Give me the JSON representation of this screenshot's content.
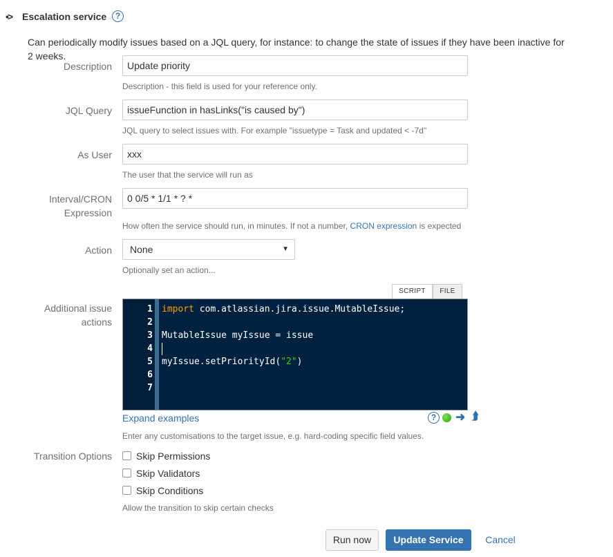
{
  "header": {
    "expander": "•>",
    "title": "Escalation service",
    "help": "?",
    "description": "Can periodically modify issues based on a JQL query, for instance: to change the state of issues if they have been inactive for 2 weeks."
  },
  "fields": {
    "description": {
      "label": "Description",
      "value": "Update priority",
      "hint": "Description - this field is used for your reference only."
    },
    "jql": {
      "label": "JQL Query",
      "value": "issueFunction in hasLinks(\"is caused by\")",
      "hint": "JQL query to select issues with. For example \"issuetype = Task and updated < -7d\""
    },
    "as_user": {
      "label": "As User",
      "value": "xxx",
      "hint": "The user that the service will run as"
    },
    "interval": {
      "label_line1": "Interval/CRON",
      "label_line2": "Expression",
      "value": "0 0/5 * 1/1 * ? *",
      "hint_prefix": "How often the service should run, in minutes. If not a number,",
      "hint_link": "CRON expression",
      "hint_suffix": "is expected"
    },
    "action": {
      "label": "Action",
      "selected": "None",
      "caret": "▼",
      "hint": "Optionally set an action..."
    }
  },
  "additional_actions": {
    "label_line1": "Additional issue",
    "label_line2": "actions",
    "tabs": {
      "script": "SCRIPT",
      "file": "FILE"
    },
    "line_numbers": [
      "1",
      "2",
      "3",
      "4",
      "5",
      "6",
      "7"
    ],
    "code": {
      "line1_kw": "import",
      "line1_rest": " com.atlassian.jira.issue.MutableIssue;",
      "line3": "MutableIssue myIssue = issue",
      "line5_pre": "myIssue.setPriorityId(",
      "line5_str": "\"2\"",
      "line5_post": ")"
    },
    "expand_link": "Expand examples",
    "help": "?",
    "arrow_right": "➜",
    "arrow_up": "⮭",
    "hint": "Enter any customisations to the target issue, e.g. hard-coding specific field values."
  },
  "transition": {
    "label": "Transition Options",
    "options": [
      "Skip Permissions",
      "Skip Validators",
      "Skip Conditions"
    ],
    "hint": "Allow the transition to skip certain checks"
  },
  "buttons": {
    "run_now": "Run now",
    "update_service": "Update Service",
    "cancel": "Cancel"
  }
}
